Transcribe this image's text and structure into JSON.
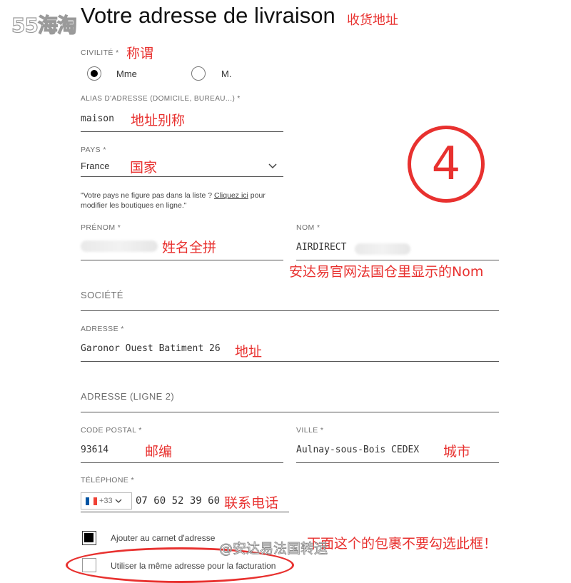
{
  "watermark": {
    "logo": "55海淘",
    "footer": "@安达易法国转运"
  },
  "page": {
    "title": "Votre adresse de livraison",
    "title_note": "收货地址"
  },
  "step_marker": "④",
  "civility": {
    "label": "CIVILITÉ *",
    "note": "称谓",
    "options": [
      {
        "label": "Mme",
        "selected": true
      },
      {
        "label": "M.",
        "selected": false
      }
    ]
  },
  "alias": {
    "label": "ALIAS D'ADRESSE (DOMICILE, BUREAU...) *",
    "value": "maison",
    "note": "地址别称"
  },
  "country": {
    "label": "PAYS *",
    "value": "France",
    "note": "国家",
    "help_prefix": "\"Votre pays ne figure pas dans la liste ?",
    "help_link": "Cliquez ici",
    "help_suffix": "pour",
    "help_line2": "modifier les boutiques en ligne.\""
  },
  "first_name": {
    "label": "PRÉNOM *",
    "value": "",
    "note": "姓名全拼"
  },
  "last_name": {
    "label": "NOM *",
    "value": "AIRDIRECT",
    "note": "安达易官网法国仓里显示的Nom"
  },
  "company": {
    "placeholder": "SOCIÉTÉ"
  },
  "address": {
    "label": "ADRESSE *",
    "value": "Garonor Ouest Batiment 26",
    "note": "地址"
  },
  "address2": {
    "placeholder": "ADRESSE (LIGNE 2)"
  },
  "postal_code": {
    "label": "CODE POSTAL *",
    "value": "93614",
    "note": "邮编"
  },
  "city": {
    "label": "VILLE *",
    "value": "Aulnay-sous-Bois CEDEX",
    "note": "城市"
  },
  "phone": {
    "label": "TÉLÉPHONE *",
    "dial_code": "+33",
    "value": "07 60 52 39 60",
    "note": "联系电话"
  },
  "checkboxes": {
    "add_to_book": {
      "label": "Ajouter au carnet d'adresse",
      "checked": true
    },
    "same_billing": {
      "label": "Utiliser la même adresse pour la facturation",
      "checked": false,
      "note": "下面这个的包裹不要勾选此框！"
    }
  },
  "colors": {
    "annotation": "#e8312f",
    "text": "#333333",
    "line": "#555555"
  }
}
